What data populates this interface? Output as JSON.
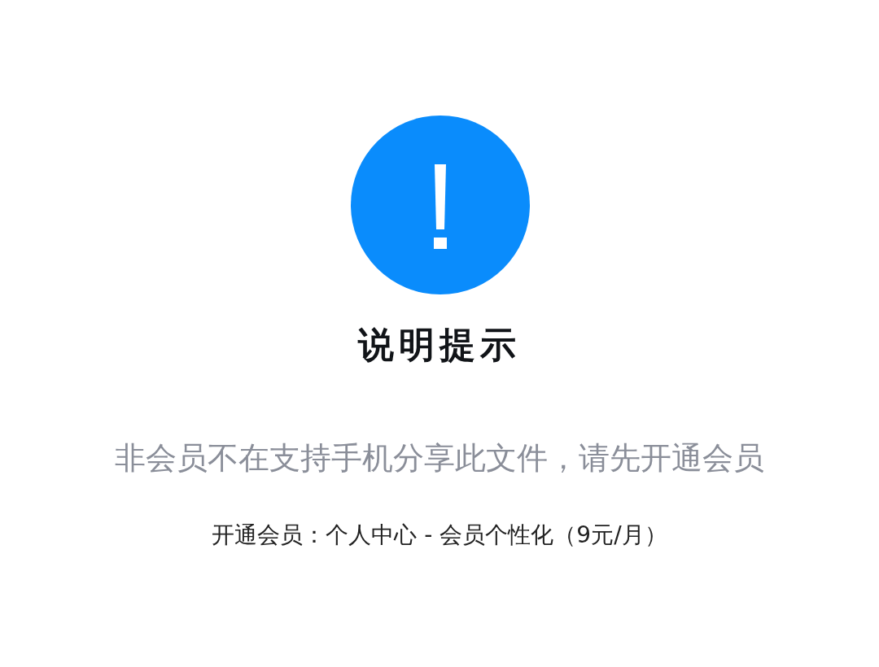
{
  "dialog": {
    "title": "说明提示",
    "message": "非会员不在支持手机分享此文件，请先开通会员",
    "note": "开通会员：个人中心 - 会员个性化（9元/月）"
  }
}
